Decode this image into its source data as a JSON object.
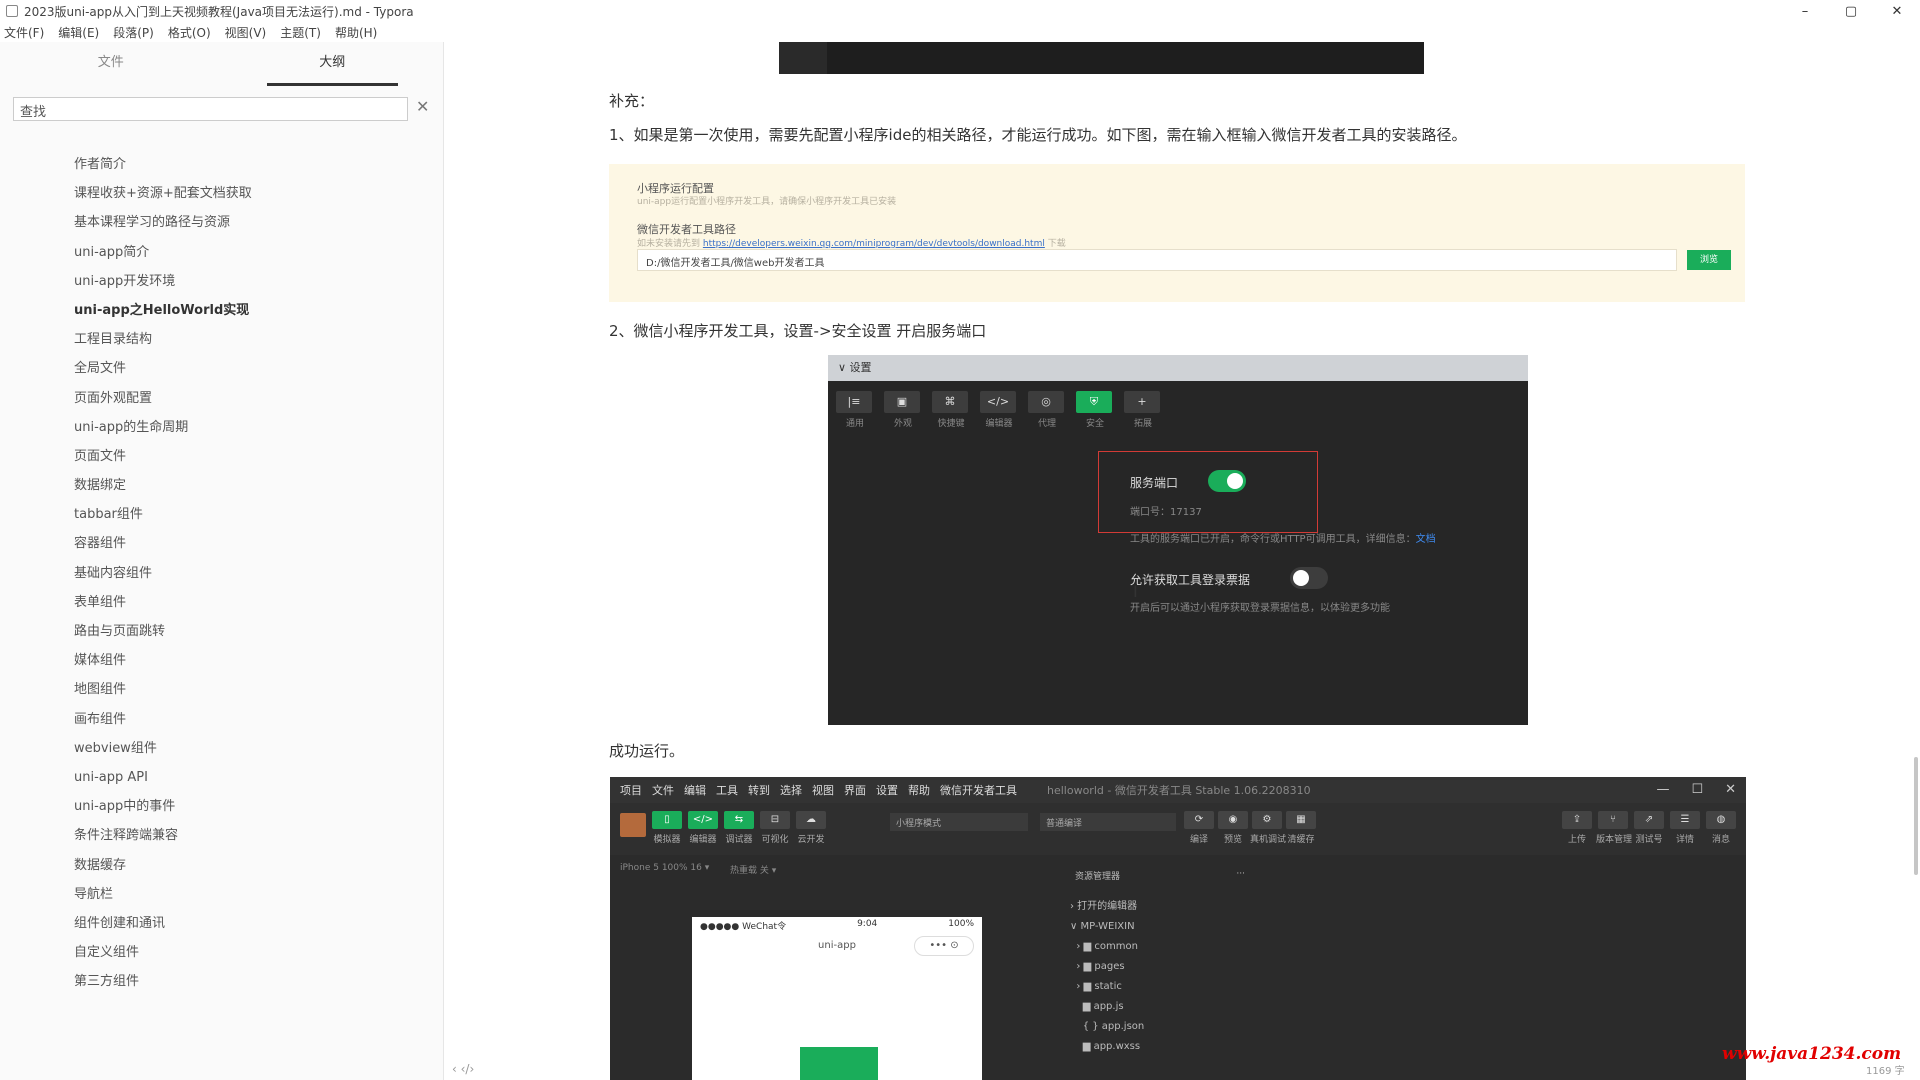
{
  "window": {
    "title": "2023版uni-app从入门到上天视频教程(Java项目无法运行).md - Typora",
    "minimize": "–",
    "maximize": "▢",
    "close": "✕"
  },
  "menu": [
    "文件(F)",
    "编辑(E)",
    "段落(P)",
    "格式(O)",
    "视图(V)",
    "主题(T)",
    "帮助(H)"
  ],
  "sidebar": {
    "tabs": [
      "文件",
      "大纲"
    ],
    "search_value": "查找",
    "clear": "✕",
    "items": [
      {
        "label": "作者简介",
        "bold": false
      },
      {
        "label": "课程收获+资源+配套文档获取",
        "bold": false
      },
      {
        "label": "基本课程学习的路径与资源",
        "bold": false
      },
      {
        "label": "uni-app简介",
        "bold": false
      },
      {
        "label": "uni-app开发环境",
        "bold": false
      },
      {
        "label": "uni-app之HelloWorld实现",
        "bold": true
      },
      {
        "label": "工程目录结构",
        "bold": false
      },
      {
        "label": "全局文件",
        "bold": false
      },
      {
        "label": "页面外观配置",
        "bold": false
      },
      {
        "label": "uni-app的生命周期",
        "bold": false
      },
      {
        "label": "页面文件",
        "bold": false
      },
      {
        "label": "数据绑定",
        "bold": false
      },
      {
        "label": "tabbar组件",
        "bold": false
      },
      {
        "label": "容器组件",
        "bold": false
      },
      {
        "label": "基础内容组件",
        "bold": false
      },
      {
        "label": "表单组件",
        "bold": false
      },
      {
        "label": "路由与页面跳转",
        "bold": false
      },
      {
        "label": "媒体组件",
        "bold": false
      },
      {
        "label": "地图组件",
        "bold": false
      },
      {
        "label": "画布组件",
        "bold": false
      },
      {
        "label": "webview组件",
        "bold": false
      },
      {
        "label": "uni-app API",
        "bold": false
      },
      {
        "label": "uni-app中的事件",
        "bold": false
      },
      {
        "label": "条件注释跨端兼容",
        "bold": false
      },
      {
        "label": "数据缓存",
        "bold": false
      },
      {
        "label": "导航栏",
        "bold": false
      },
      {
        "label": "组件创建和通讯",
        "bold": false
      },
      {
        "label": "自定义组件",
        "bold": false
      },
      {
        "label": "第三方组件",
        "bold": false
      }
    ],
    "footer": "‹  ‹/›"
  },
  "content": {
    "supplement": "补充：",
    "step1": "1、如果是第一次使用，需要先配置小程序ide的相关路径，才能运行成功。如下图，需在输入框输入微信开发者工具的安装路径。",
    "config": {
      "title": "小程序运行配置",
      "subtitle": "uni-app运行配置小程序开发工具，请确保小程序开发工具已安装",
      "path_label": "微信开发者工具路径",
      "link_prefix": "如未安装请先到",
      "link_url": "https://developers.weixin.qq.com/miniprogram/dev/devtools/download.html",
      "link_suffix": "下载",
      "path_value": "D:/微信开发者工具/微信web开发者工具",
      "browse": "浏览"
    },
    "step2": "2、微信小程序开发工具，设置->安全设置 开启服务端口",
    "settings": {
      "header": "∨ 设置",
      "toolbar": [
        {
          "icon": "|≡",
          "label": "通用",
          "active": false
        },
        {
          "icon": "▣",
          "label": "外观",
          "active": false
        },
        {
          "icon": "⌘",
          "label": "快捷键",
          "active": false
        },
        {
          "icon": "</>",
          "label": "编辑器",
          "active": false
        },
        {
          "icon": "◎",
          "label": "代理",
          "active": false
        },
        {
          "icon": "⛨",
          "label": "安全",
          "active": true
        },
        {
          "icon": "+",
          "label": "拓展",
          "active": false
        }
      ],
      "service_port_label": "服务端口",
      "port_text": "端口号：17137",
      "service_port_desc": "工具的服务端口已开启，命令行或HTTP可调用工具，详细信息：",
      "service_port_link": "文档",
      "allow_label": "允许获取工具登录票据",
      "allow_desc": "开启后可以通过小程序获取登录票据信息，以体验更多功能"
    },
    "success": "成功运行。",
    "devtools": {
      "menu": [
        "项目",
        "文件",
        "编辑",
        "工具",
        "转到",
        "选择",
        "视图",
        "界面",
        "设置",
        "帮助",
        "微信开发者工具"
      ],
      "title": "helloworld - 微信开发者工具 Stable 1.06.2208310",
      "controls": [
        "—",
        "☐",
        "✕"
      ],
      "left_buttons": [
        {
          "icon": "▯",
          "label": "模拟器",
          "green": true
        },
        {
          "icon": "</>",
          "label": "编辑器",
          "green": true
        },
        {
          "icon": "⇆",
          "label": "调试器",
          "green": true
        },
        {
          "icon": "⊟",
          "label": "可视化",
          "green": false
        },
        {
          "icon": "☁",
          "label": "云开发",
          "green": false
        }
      ],
      "mode_select": "小程序模式",
      "compile_select": "普通编译",
      "mid_buttons": [
        {
          "icon": "⟳",
          "label": "编译"
        },
        {
          "icon": "◉",
          "label": "预览"
        },
        {
          "icon": "⚙",
          "label": "真机调试"
        },
        {
          "icon": "▦",
          "label": "清缓存"
        }
      ],
      "right_buttons": [
        {
          "icon": "⇪",
          "label": "上传"
        },
        {
          "icon": "⑂",
          "label": "版本管理"
        },
        {
          "icon": "⇗",
          "label": "测试号"
        },
        {
          "icon": "☰",
          "label": "详情"
        },
        {
          "icon": "◍",
          "label": "消息"
        }
      ],
      "device": "iPhone 5 100% 16 ▾",
      "hot_reload": "热重载 关 ▾",
      "phone": {
        "carrier": "●●●●● WeChat令",
        "time": "9:04",
        "battery": "100%",
        "nav_title": "uni-app",
        "capsule": "•••  ⊙"
      },
      "explorer_title": "资源管理器",
      "explorer_more": "···",
      "tree": [
        "› 打开的编辑器",
        "∨ MP-WEIXIN",
        "  › ▆ common",
        "  › ▆ pages",
        "  › ▆ static",
        "    ▆ app.js",
        "    { } app.json",
        "    ▆ app.wxss"
      ]
    }
  },
  "watermark": "www.java1234.com",
  "word_count": "1169 字"
}
